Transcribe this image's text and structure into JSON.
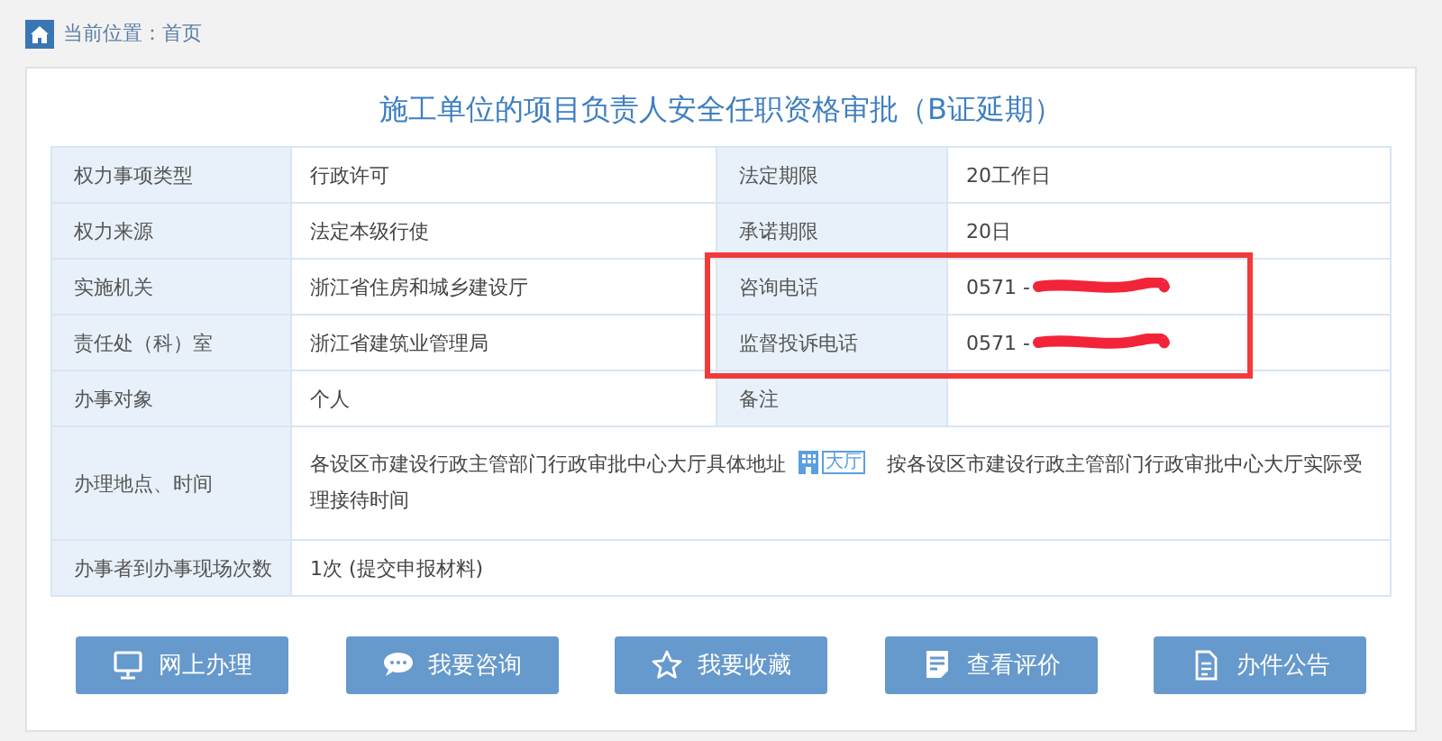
{
  "breadcrumb": {
    "text": "当前位置：首页"
  },
  "title": "施工单位的项目负责人安全任职资格审批（B证延期）",
  "rows": [
    {
      "kind": "pair",
      "cells": [
        {
          "label": "权力事项类型",
          "value": "行政许可"
        },
        {
          "label": "法定期限",
          "value": "20工作日"
        }
      ]
    },
    {
      "kind": "pair",
      "cells": [
        {
          "label": "权力来源",
          "value": "法定本级行使"
        },
        {
          "label": "承诺期限",
          "value": "20日"
        }
      ]
    },
    {
      "kind": "pair",
      "cells": [
        {
          "label": "实施机关",
          "value": "浙江省住房和城乡建设厅"
        },
        {
          "label": "咨询电话",
          "value": "0571 -",
          "redacted": true,
          "highlighted": true
        }
      ]
    },
    {
      "kind": "pair",
      "cells": [
        {
          "label": "责任处（科）室",
          "value": "浙江省建筑业管理局"
        },
        {
          "label": "监督投诉电话",
          "value": "0571 -",
          "redacted": true,
          "highlighted": true
        }
      ]
    },
    {
      "kind": "pair",
      "cells": [
        {
          "label": "办事对象",
          "value": "个人"
        },
        {
          "label": "备注"
        }
      ]
    },
    {
      "kind": "location",
      "label": "办理地点、时间",
      "address": "各设区市建设行政主管部门行政审批中心大厅具体地址",
      "badge": "大厅",
      "hours": "按各设区市建设行政主管部门行政审批中心大厅实际受理接待时间"
    },
    {
      "kind": "wide",
      "label": "办事者到办事现场次数",
      "value": "1次 (提交申报材料)"
    }
  ],
  "buttons": [
    {
      "kind": "monitor",
      "label": "网上办理"
    },
    {
      "kind": "chat",
      "label": "我要咨询"
    },
    {
      "kind": "star",
      "label": "我要收藏"
    },
    {
      "kind": "review",
      "label": "查看评价"
    },
    {
      "kind": "notice",
      "label": "办件公告"
    }
  ]
}
